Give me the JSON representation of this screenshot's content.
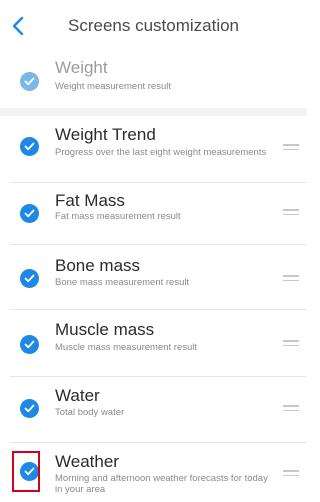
{
  "header": {
    "title": "Screens customization",
    "back_icon": "chevron-left-icon",
    "accent_color": "#1e88e5"
  },
  "fixed_item": {
    "title": "Weight",
    "description": "Weight measurement result",
    "enabled": true
  },
  "items": [
    {
      "title": "Weight Trend",
      "description": "Progress over the last eight weight measurements",
      "enabled": true
    },
    {
      "title": "Fat Mass",
      "description": "Fat mass measurement result",
      "enabled": true
    },
    {
      "title": "Bone mass",
      "description": "Bone mass measurement result",
      "enabled": true
    },
    {
      "title": "Muscle mass",
      "description": "Muscle mass measurement result",
      "enabled": true
    },
    {
      "title": "Water",
      "description": "Total body water",
      "enabled": true
    },
    {
      "title": "Weather",
      "description": "Morning and afternoon weather forecasts for today in your area",
      "enabled": true
    }
  ],
  "highlight_color": "#d0021b"
}
